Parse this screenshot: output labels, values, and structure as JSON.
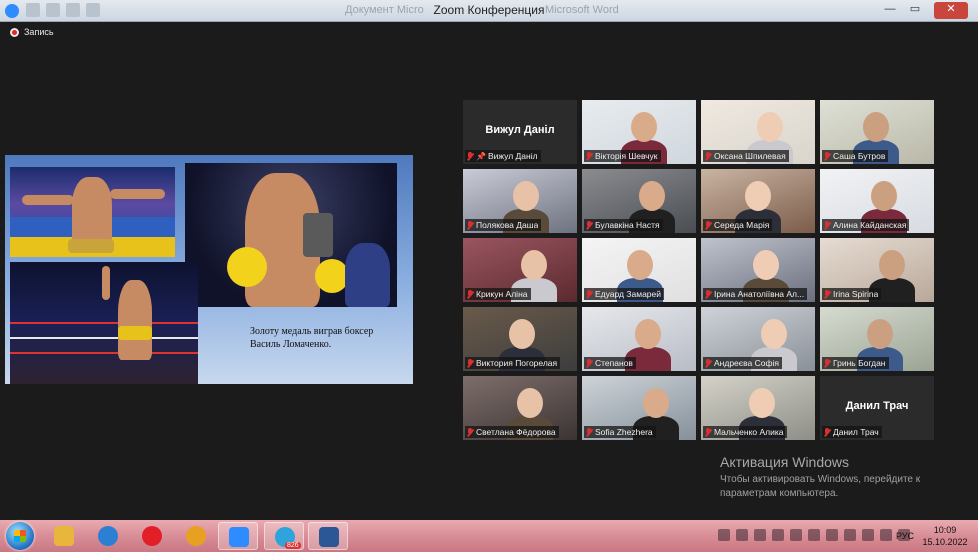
{
  "window": {
    "title": "Zoom Конференция",
    "ghost_left": "Документ Micro",
    "ghost_right": "Microsoft Word",
    "minimize": "—",
    "maximize": "▭",
    "close": "✕"
  },
  "recording": {
    "label": "Запись"
  },
  "slide": {
    "caption_line1": "Золоту медаль виграв боксер",
    "caption_line2": "Василь Ломаченко."
  },
  "participants": [
    {
      "name": "Вижул Даніл",
      "display": "Вижул Даніл",
      "pinned": true,
      "video": false
    },
    {
      "name": "Вікторія Шевчук",
      "video": true
    },
    {
      "name": "Оксана Шпилевая",
      "video": true
    },
    {
      "name": "Саша Бутров",
      "video": true
    },
    {
      "name": "Полякова Даша",
      "video": true,
      "active": true
    },
    {
      "name": "Булавкіна Настя",
      "video": true
    },
    {
      "name": "Середа Марія",
      "video": true
    },
    {
      "name": "Алина Кайданская",
      "video": true
    },
    {
      "name": "Крикун Аліна",
      "video": true
    },
    {
      "name": "Едуард Замарей",
      "video": true
    },
    {
      "name": "Ірина Анатоліївна Ал...",
      "video": true
    },
    {
      "name": "Irina Spirina",
      "video": true
    },
    {
      "name": "Виктория Погорелая",
      "video": true
    },
    {
      "name": "Степанов",
      "video": true
    },
    {
      "name": "Андреєва Софія",
      "video": true
    },
    {
      "name": "Гринь Богдан",
      "video": true
    },
    {
      "name": "Светлана Фёдорова",
      "video": true
    },
    {
      "name": "Sofia Zhezhera",
      "video": true
    },
    {
      "name": "Мальченко Алика",
      "video": true
    },
    {
      "name": "Данил Трач",
      "display": "Данил Трач",
      "video": false
    }
  ],
  "watermark": {
    "title": "Активация Windows",
    "line1": "Чтобы активировать Windows, перейдите к",
    "line2": "параметрам компьютера."
  },
  "taskbar": {
    "telegram_badge": "826",
    "language": "РУС",
    "time": "10:09",
    "date": "15.10.2022"
  }
}
